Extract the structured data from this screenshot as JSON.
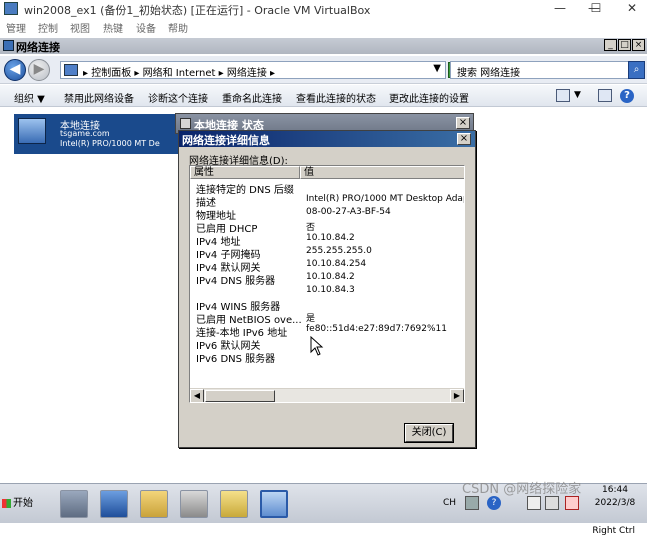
{
  "host": {
    "title": "win2008_ex1 (备份1_初始状态) [正在运行] - Oracle VM VirtualBox",
    "menu": [
      "管理",
      "控制",
      "视图",
      "热键",
      "设备",
      "帮助"
    ],
    "window_controls": [
      "—",
      "☐",
      "✕"
    ]
  },
  "explorer": {
    "title": "网络连接",
    "address_segments": "▸ 控制面板 ▸ 网络和 Internet ▸ 网络连接 ▸",
    "search_placeholder": "搜索 网络连接",
    "commands": [
      "组织 ▼",
      "禁用此网络设备",
      "诊断这个连接",
      "重命名此连接",
      "查看此连接的状态",
      "更改此连接的设置"
    ],
    "connection": {
      "name": "本地连接",
      "network": "tsgame.com",
      "adapter": "Intel(R) PRO/1000 MT De"
    }
  },
  "status_window": {
    "title": "本地连接 状态"
  },
  "details_dialog": {
    "title": "网络连接详细信息",
    "list_label": "网络连接详细信息(D):",
    "columns": [
      "属性",
      "值"
    ],
    "rows": [
      {
        "p": "连接特定的 DNS 后缀",
        "v": ""
      },
      {
        "p": "描述",
        "v": "Intel(R) PRO/1000 MT Desktop Adap"
      },
      {
        "p": "物理地址",
        "v": "08-00-27-A3-BF-54"
      },
      {
        "p": "已启用 DHCP",
        "v": "否"
      },
      {
        "p": "IPv4 地址",
        "v": "10.10.84.2"
      },
      {
        "p": "IPv4 子网掩码",
        "v": "255.255.255.0"
      },
      {
        "p": "IPv4 默认网关",
        "v": "10.10.84.254"
      },
      {
        "p": "IPv4 DNS 服务器",
        "v": "10.10.84.2"
      },
      {
        "p": "",
        "v": "10.10.84.3"
      },
      {
        "p": "IPv4 WINS 服务器",
        "v": ""
      },
      {
        "p": "已启用 NetBIOS ove...",
        "v": "是"
      },
      {
        "p": "连接-本地 IPv6 地址",
        "v": "fe80::51d4:e27:89d7:7692%11"
      },
      {
        "p": "IPv6 默认网关",
        "v": ""
      },
      {
        "p": "IPv6 DNS 服务器",
        "v": ""
      }
    ],
    "close_label": "关闭(C)"
  },
  "taskbar": {
    "start_label": "开始",
    "tray_lang": "CH",
    "time": "16:44",
    "date": "2022/3/8",
    "host_key": "Right Ctrl"
  },
  "watermark": "CSDN @网络探险家"
}
